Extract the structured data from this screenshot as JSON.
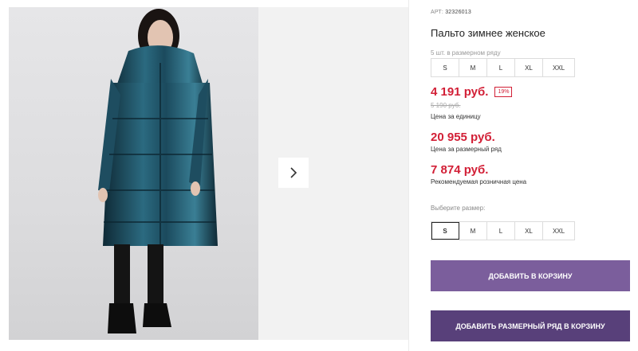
{
  "product": {
    "art_label": "АРТ:",
    "art_number": "32326013",
    "title": "Пальто зимнее женское",
    "size_row_label": "5 шт. в размерном ряду",
    "sizes": [
      "S",
      "M",
      "L",
      "XL",
      "XXL"
    ],
    "selected_size": "S"
  },
  "prices": {
    "unit_price": "4 191 руб.",
    "discount": "19%",
    "old_price": "5 190 руб.",
    "unit_note": "Цена за единицу",
    "row_price": "20 955 руб.",
    "row_note": "Цена за размерный ряд",
    "retail_price": "7 874 руб.",
    "retail_note": "Рекомендуемая розничная цена"
  },
  "choose_size_label": "Выберите размер:",
  "buttons": {
    "add_to_cart": "ДОБАВИТЬ В КОРЗИНУ",
    "add_row_to_cart": "ДОБАВИТЬ РАЗМЕРНЫЙ РЯД В КОРЗИНУ"
  },
  "gallery": {
    "next_icon": "chevron-right-icon"
  },
  "colors": {
    "price_red": "#d21f36",
    "button_primary": "#7b5e9c",
    "button_dark": "#58407a",
    "coat": "#1f4a5c"
  }
}
